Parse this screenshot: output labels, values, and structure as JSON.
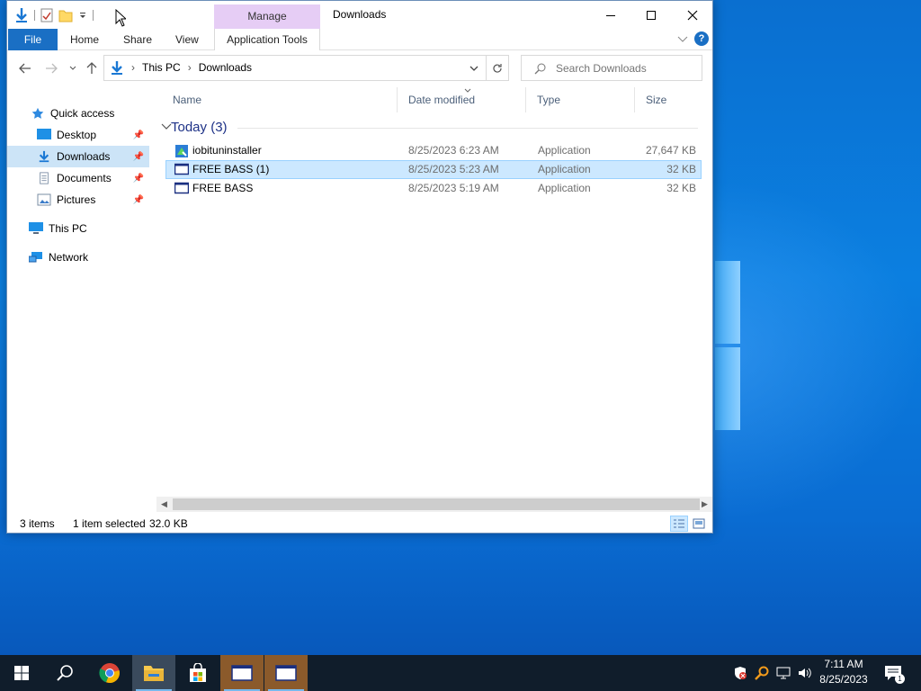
{
  "window": {
    "title": "Downloads",
    "manage_label": "Manage",
    "ribbon_tabs": {
      "file": "File",
      "home": "Home",
      "share": "Share",
      "view": "View",
      "app_tools": "Application Tools"
    }
  },
  "address": {
    "crumbs": [
      "This PC",
      "Downloads"
    ],
    "search_placeholder": "Search Downloads"
  },
  "sidebar": {
    "items": [
      {
        "label": "Quick access"
      },
      {
        "label": "Desktop"
      },
      {
        "label": "Downloads"
      },
      {
        "label": "Documents"
      },
      {
        "label": "Pictures"
      },
      {
        "label": "This PC"
      },
      {
        "label": "Network"
      }
    ]
  },
  "columns": {
    "name": "Name",
    "date": "Date modified",
    "type": "Type",
    "size": "Size"
  },
  "group": {
    "label": "Today (3)"
  },
  "files": [
    {
      "name": "iobituninstaller",
      "date": "8/25/2023 6:23 AM",
      "type": "Application",
      "size": "27,647 KB"
    },
    {
      "name": "FREE BASS (1)",
      "date": "8/25/2023 5:23 AM",
      "type": "Application",
      "size": "32 KB"
    },
    {
      "name": "FREE BASS",
      "date": "8/25/2023 5:19 AM",
      "type": "Application",
      "size": "32 KB"
    }
  ],
  "status": {
    "count": "3 items",
    "selected": "1 item selected",
    "size": "32.0 KB"
  },
  "clock": {
    "time": "7:11 AM",
    "date": "8/25/2023"
  },
  "notification_count": "1",
  "colors": {
    "accent": "#1a6fc4",
    "selection": "#cce8ff",
    "taskbar": "#101d2b",
    "manage_tab": "#e6cdf5"
  }
}
